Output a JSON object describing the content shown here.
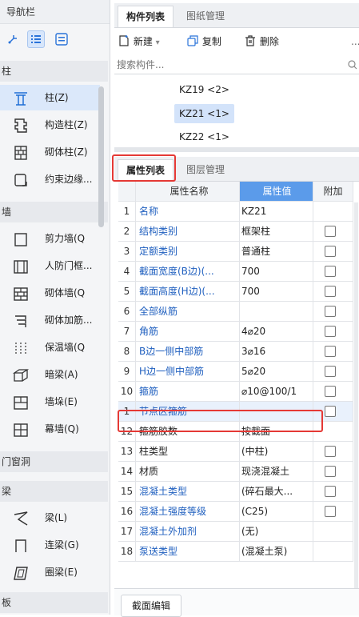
{
  "nav": {
    "title": "导航栏",
    "categories": {
      "column": "柱",
      "wall": "墙",
      "door_window": "门窗洞",
      "beam": "梁",
      "slab": "板"
    },
    "items": [
      {
        "label": "柱(Z)",
        "icon": "column-icon"
      },
      {
        "label": "构造柱(Z)",
        "icon": "construct-column-icon"
      },
      {
        "label": "砌体柱(Z)",
        "icon": "masonry-column-icon"
      },
      {
        "label": "约束边缘...",
        "icon": "boundary-column-icon"
      },
      {
        "label": "剪力墙(Q",
        "icon": "shear-wall-icon"
      },
      {
        "label": "人防门框...",
        "icon": "civil-defense-door-icon"
      },
      {
        "label": "砌体墙(Q",
        "icon": "masonry-wall-icon"
      },
      {
        "label": "砌体加筋...",
        "icon": "masonry-rebar-icon"
      },
      {
        "label": "保温墙(Q",
        "icon": "insulation-wall-icon"
      },
      {
        "label": "暗梁(A)",
        "icon": "hidden-beam-icon"
      },
      {
        "label": "墙垛(E)",
        "icon": "wall-pier-icon"
      },
      {
        "label": "幕墙(Q)",
        "icon": "curtain-wall-icon"
      },
      {
        "label": "梁(L)",
        "icon": "beam-icon"
      },
      {
        "label": "连梁(G)",
        "icon": "coupling-beam-icon"
      },
      {
        "label": "圈梁(E)",
        "icon": "ring-beam-icon"
      }
    ]
  },
  "top_panel": {
    "tabs": [
      "构件列表",
      "图纸管理"
    ],
    "toolbar": {
      "new_label": "新建",
      "copy_label": "复制",
      "delete_label": "删除"
    },
    "search": {
      "placeholder": "搜索构件..."
    },
    "components": [
      "KZ19 <2>",
      "KZ21 <1>",
      "KZ22 <1>"
    ]
  },
  "bottom_panel": {
    "tabs": [
      "属性列表",
      "图层管理"
    ],
    "headers": {
      "name": "属性名称",
      "value": "属性值",
      "add": "附加"
    },
    "rows": [
      {
        "no": "1",
        "name": "名称",
        "value": "KZ21",
        "check": false
      },
      {
        "no": "2",
        "name": "结构类别",
        "value": "框架柱",
        "check": true
      },
      {
        "no": "3",
        "name": "定额类别",
        "value": "普通柱",
        "check": true
      },
      {
        "no": "4",
        "name": "截面宽度(B边)(...",
        "value": "700",
        "check": true
      },
      {
        "no": "5",
        "name": "截面高度(H边)(...",
        "value": "700",
        "check": true
      },
      {
        "no": "6",
        "name": "全部纵筋",
        "value": "",
        "check": true
      },
      {
        "no": "7",
        "name": "角筋",
        "value": "4⌀20",
        "check": true
      },
      {
        "no": "8",
        "name": "B边一侧中部筋",
        "value": "3⌀16",
        "check": true
      },
      {
        "no": "9",
        "name": "H边一侧中部筋",
        "value": "5⌀20",
        "check": true
      },
      {
        "no": "10",
        "name": "箍筋",
        "value": "⌀10@100/1",
        "check": true
      },
      {
        "no": "1",
        "name": "节点区箍筋",
        "value": "",
        "check": true
      },
      {
        "no": "12",
        "name": "箍筋胶数",
        "value": "按截面",
        "check": false
      },
      {
        "no": "13",
        "name": "柱类型",
        "value": "(中柱)",
        "check": true
      },
      {
        "no": "14",
        "name": "材质",
        "value": "现浇混凝土",
        "check": true
      },
      {
        "no": "15",
        "name": "混凝土类型",
        "value": "(碎石最大...",
        "check": true
      },
      {
        "no": "16",
        "name": "混凝土强度等级",
        "value": "(C25)",
        "check": true
      },
      {
        "no": "17",
        "name": "混凝土外加剂",
        "value": "(无)",
        "check": false
      },
      {
        "no": "18",
        "name": "泵送类型",
        "value": "(混凝土泵)",
        "check": false
      }
    ],
    "section_edit_label": "截面编辑"
  },
  "colors": {
    "accent": "#5b9bea",
    "highlight_red": "#e53935",
    "link_blue": "#1f5fbf"
  }
}
